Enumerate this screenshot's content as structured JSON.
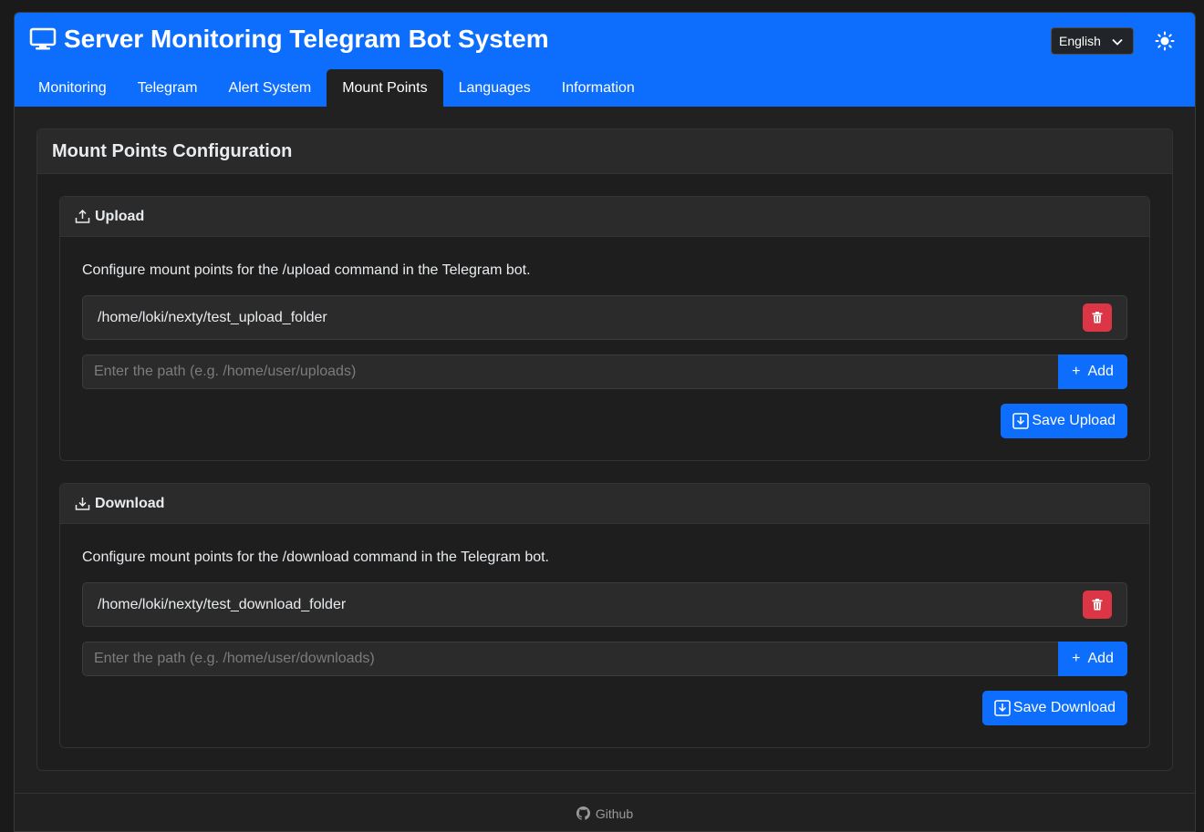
{
  "app": {
    "title": "Server Monitoring Telegram Bot System",
    "language": "English",
    "theme_icon": "sun-icon"
  },
  "tabs": [
    {
      "label": "Monitoring",
      "active": false
    },
    {
      "label": "Telegram",
      "active": false
    },
    {
      "label": "Alert System",
      "active": false
    },
    {
      "label": "Mount Points",
      "active": true
    },
    {
      "label": "Languages",
      "active": false
    },
    {
      "label": "Information",
      "active": false
    }
  ],
  "main": {
    "title": "Mount Points Configuration",
    "upload": {
      "title": "Upload",
      "icon": "upload-icon",
      "description": "Configure mount points for the /upload command in the Telegram bot.",
      "mount_points": [
        "/home/loki/nexty/test_upload_folder"
      ],
      "input_placeholder": "Enter the path (e.g. /home/user/uploads)",
      "add_label": "Add",
      "save_label": "Save Upload"
    },
    "download": {
      "title": "Download",
      "icon": "download-icon",
      "description": "Configure mount points for the /download command in the Telegram bot.",
      "mount_points": [
        "/home/loki/nexty/test_download_folder"
      ],
      "input_placeholder": "Enter the path (e.g. /home/user/downloads)",
      "add_label": "Add",
      "save_label": "Save Download"
    }
  },
  "footer": {
    "link_label": "Github",
    "icon": "github-icon"
  },
  "colors": {
    "primary": "#0d6efd",
    "danger": "#dc3545",
    "background": "#212121"
  }
}
